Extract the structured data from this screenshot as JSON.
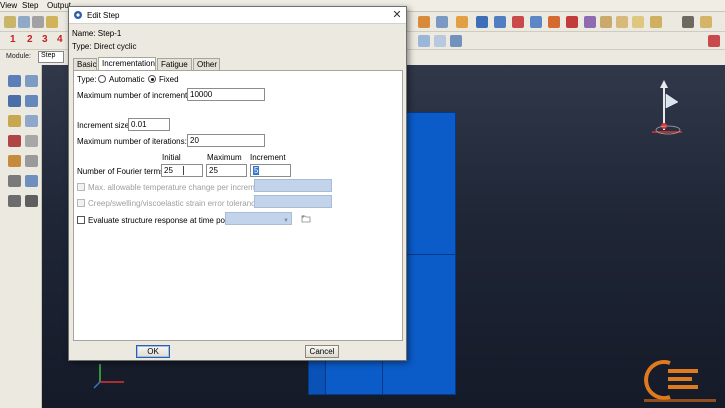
{
  "menubar": {
    "items": [
      "View",
      "Step",
      "Output"
    ]
  },
  "toolbar": {
    "step_numbers": [
      "1",
      "2",
      "3",
      "4"
    ],
    "module_label": "Module:",
    "module_value": "Step"
  },
  "dialog": {
    "title": "Edit Step",
    "close_glyph": "✕",
    "name_label": "Name:",
    "name_value": "Step-1",
    "type_label": "Type:",
    "type_value": "Direct cyclic",
    "tabs": [
      {
        "label": "Basic",
        "active": false
      },
      {
        "label": "Incrementation",
        "active": true
      },
      {
        "label": "Fatigue",
        "active": false
      },
      {
        "label": "Other",
        "active": false
      }
    ],
    "incrementation": {
      "type_label": "Type:",
      "type_options": [
        {
          "label": "Automatic",
          "selected": false
        },
        {
          "label": "Fixed",
          "selected": true
        }
      ],
      "max_increments_label": "Maximum number of increments:",
      "max_increments_value": "10000",
      "increment_size_label": "Increment size:",
      "increment_size_value": "0.01",
      "max_iterations_label": "Maximum number of iterations:",
      "max_iterations_value": "20",
      "fourier_headers": [
        "Initial",
        "Maximum",
        "Increment"
      ],
      "fourier_label": "Number of Fourier terms:",
      "fourier_initial": "25",
      "fourier_maximum": "25",
      "fourier_increment": "5",
      "max_temp_label": "Max. allowable temperature change per  increment:",
      "creep_label": "Creep/swelling/viscoelastic strain error tolerance:",
      "evaluate_label": "Evaluate structure response at time points:",
      "evaluate_checked": false
    },
    "ok_label": "OK",
    "cancel_label": "Cancel"
  },
  "colors": {
    "part_blue": "#0b5cc9",
    "viewport_top": "#30384a",
    "viewport_bottom": "#141a28",
    "disabled_field": "#c2d4ec"
  }
}
